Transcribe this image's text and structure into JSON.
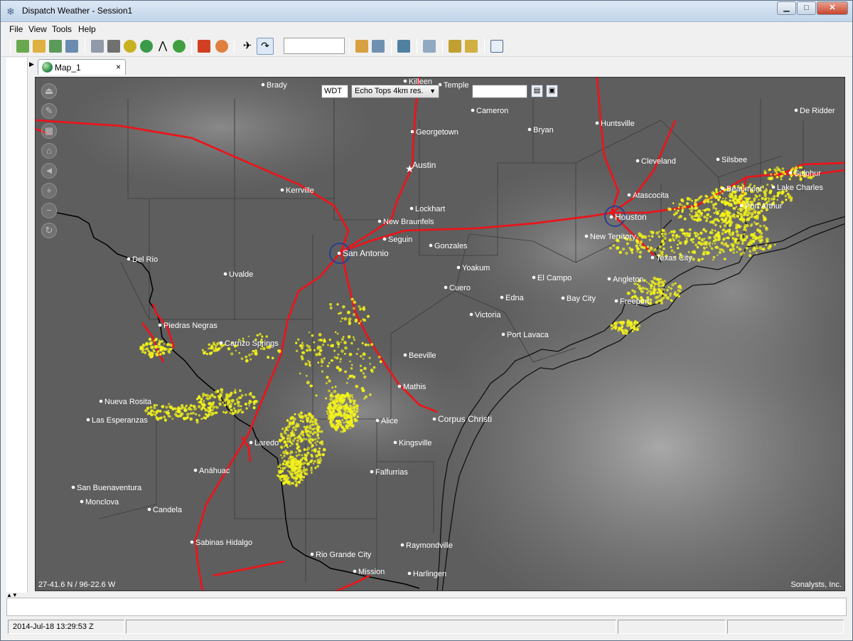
{
  "window": {
    "title": "Dispatch Weather - Session1"
  },
  "menu": {
    "items": [
      "File",
      "View",
      "Tools",
      "Help"
    ]
  },
  "toolbar": {
    "search_value": ""
  },
  "tab": {
    "label": "Map_1",
    "close": "×"
  },
  "map": {
    "station": "WDT",
    "layer": "Echo Tops 4km res.",
    "time_value": "",
    "coordinates": "27-41.6 N / 96-22.6 W",
    "attribution": "Sonalysts, Inc.",
    "cities": [
      "Killeen",
      "Temple",
      "Brady",
      "Cameron",
      "Georgetown",
      "Bryan",
      "Huntsville",
      "De Ridder",
      "Austin",
      "Cleveland",
      "Silsbee",
      "Sulphur",
      "Kerrville",
      "Lockhart",
      "Atascocita",
      "Beaumont",
      "Lake Charles",
      "Port Arthur",
      "New Braunfels",
      "Houston",
      "Seguin",
      "New Territory",
      "Gonzales",
      "San Antonio",
      "Del Rio",
      "Texas City",
      "Yoakum",
      "Uvalde",
      "El Campo",
      "Angleton",
      "Cuero",
      "Edna",
      "Bay City",
      "Freeport",
      "Victoria",
      "Piedras Negras",
      "Port Lavaca",
      "Carrizo Springs",
      "Beeville",
      "Mathis",
      "Nueva Rosita",
      "Corpus Christi",
      "Las Esperanzas",
      "Alice",
      "Laredo",
      "Kingsville",
      "Anáhuac",
      "Falfurrias",
      "San Buenaventura",
      "Monclova",
      "Candela",
      "Sabinas Hidalgo",
      "Raymondville",
      "Rio Grande City",
      "Mission",
      "Harlingen"
    ]
  },
  "status": {
    "datetime": "2014-Jul-18 13:29:53 Z"
  },
  "colors": {
    "road": "#e8161c",
    "lightning": "#f2f21c",
    "water": "#2b3f8f"
  }
}
